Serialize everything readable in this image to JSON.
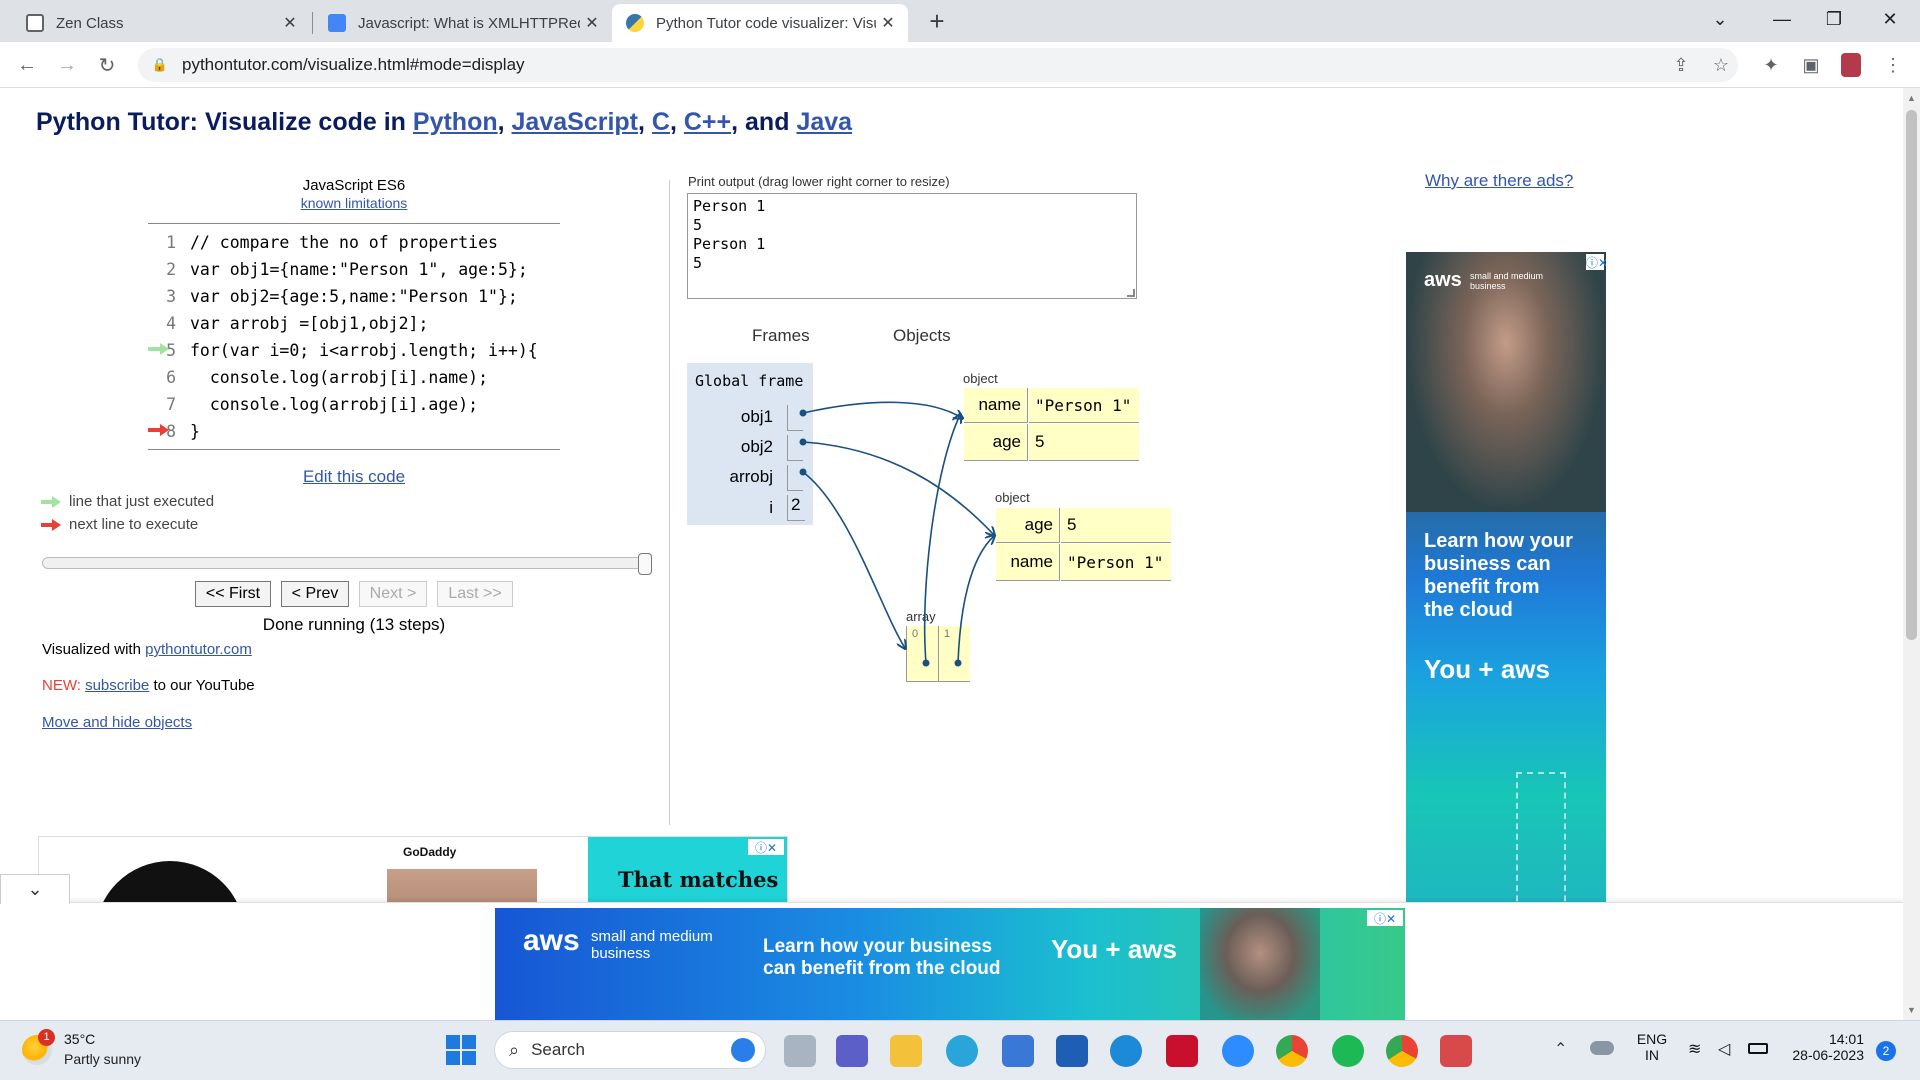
{
  "browser": {
    "tabs": [
      {
        "title": "Zen Class",
        "favicon_color": "#5f6368"
      },
      {
        "title": "Javascript: What is XMLHTTPReq",
        "favicon_color": "#4285f4"
      },
      {
        "title": "Python Tutor code visualizer: Visu",
        "favicon_color": "#3776ab"
      }
    ],
    "new_tab_glyph": "+",
    "url": "pythontutor.com/visualize.html#mode=display"
  },
  "page": {
    "title_prefix": "Python Tutor: Visualize code in ",
    "title_langs": [
      "Python",
      "JavaScript",
      "C",
      "C++",
      "Java"
    ],
    "title_sep1": ", ",
    "title_and": ", and ",
    "lang_label": "JavaScript ES6",
    "known_limitations": "known limitations",
    "code_lines": [
      {
        "n": "1",
        "text": "// compare the no of properties"
      },
      {
        "n": "2",
        "text": "var obj1={name:\"Person 1\", age:5};"
      },
      {
        "n": "3",
        "text": "var obj2={age:5,name:\"Person 1\"};"
      },
      {
        "n": "4",
        "text": "var arrobj =[obj1,obj2];"
      },
      {
        "n": "5",
        "text": "for(var i=0; i<arrobj.length; i++){"
      },
      {
        "n": "6",
        "text": "  console.log(arrobj[i].name);"
      },
      {
        "n": "7",
        "text": "  console.log(arrobj[i].age);"
      },
      {
        "n": "8",
        "text": "}"
      }
    ],
    "edit_code": "Edit this code",
    "legend_executed": "line that just executed",
    "legend_next": "next line to execute",
    "legend_executed_color": "#a2e3a2",
    "legend_next_color": "#e93f34",
    "slider_progress": 1.0,
    "buttons": {
      "first": "<< First",
      "prev": "< Prev",
      "next": "Next >",
      "last": "Last >>"
    },
    "status": "Done running (13 steps)",
    "visualized_with": "Visualized with ",
    "visualized_link": "pythontutor.com",
    "new_label": "NEW:",
    "subscribe": "subscribe",
    "youtube_text": " to our YouTube",
    "move_hide": "Move and hide objects",
    "print_label": "Print output (drag lower right corner to resize)",
    "print_lines": [
      "Person 1",
      "5",
      "Person 1",
      "5"
    ],
    "frames_header": "Frames",
    "objects_header": "Objects",
    "global_frame": "Global frame",
    "frame_vars": [
      {
        "name": "obj1",
        "value": ""
      },
      {
        "name": "obj2",
        "value": ""
      },
      {
        "name": "arrobj",
        "value": ""
      },
      {
        "name": "i",
        "value": "2"
      }
    ],
    "object1": {
      "label": "object",
      "rows": [
        {
          "key": "name",
          "val": "\"Person 1\""
        },
        {
          "key": "age",
          "val": "5"
        }
      ]
    },
    "object2": {
      "label": "object",
      "rows": [
        {
          "key": "age",
          "val": "5"
        },
        {
          "key": "name",
          "val": "\"Person 1\""
        }
      ]
    },
    "array": {
      "label": "array",
      "indices": [
        "0",
        "1"
      ]
    },
    "why_ads": "Why are there ads?"
  },
  "ads": {
    "right": {
      "brand": "aws",
      "brand_sub": "small and medium business",
      "headline": "Learn how your business can benefit from the cloud",
      "tagline_you": "You +",
      "tagline_brand": "aws"
    },
    "left_bottom": {
      "brand": "GoDaddy",
      "headline": "That matches"
    },
    "bottom": {
      "brand": "aws",
      "brand_sub1": "small and medium",
      "brand_sub2": "business",
      "headline1": "Learn how your business",
      "headline2": "can benefit from the cloud",
      "tagline_you": "You +",
      "tagline_brand": "aws"
    },
    "ad_icons": "ⓘ✕"
  },
  "taskbar": {
    "weather_temp": "35°C",
    "weather_desc": "Partly sunny",
    "weather_badge": "1",
    "search": "Search",
    "lang1": "ENG",
    "lang2": "IN",
    "time": "14:01",
    "date": "28-06-2023",
    "notif_count": "2"
  }
}
